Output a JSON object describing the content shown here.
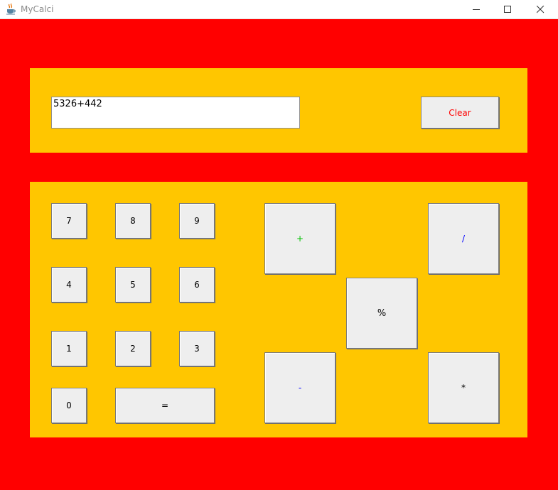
{
  "window": {
    "title": "MyCalci",
    "app_icon": "java-coffee-cup-icon",
    "controls": [
      "minimize-icon",
      "maximize-icon",
      "close-icon"
    ]
  },
  "display": {
    "value": "5326+442"
  },
  "clear_button": {
    "label": "Clear",
    "color": "#ff0000"
  },
  "keys": {
    "k7": "7",
    "k8": "8",
    "k9": "9",
    "k4": "4",
    "k5": "5",
    "k6": "6",
    "k1": "1",
    "k2": "2",
    "k3": "3",
    "k0": "0",
    "equals": "="
  },
  "operators": {
    "plus": {
      "label": "+",
      "color": "#00c000"
    },
    "divide": {
      "label": "/",
      "color": "#0000ff"
    },
    "percent": {
      "label": "%",
      "color": "#000000"
    },
    "minus": {
      "label": "-",
      "color": "#0000ff"
    },
    "multiply": {
      "label": "*",
      "color": "#000000"
    }
  },
  "colors": {
    "background": "#ff0000",
    "panel": "#ffc600",
    "button": "#eeeeee"
  }
}
